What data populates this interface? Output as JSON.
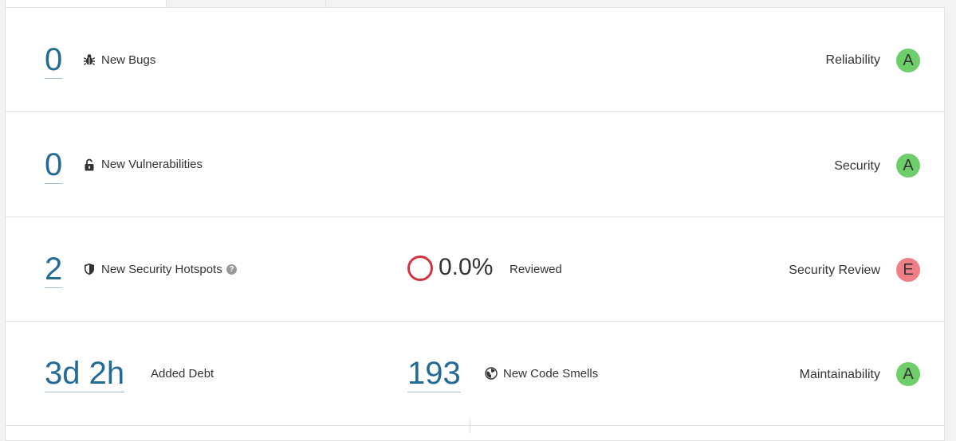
{
  "rows": [
    {
      "value": "0",
      "label": "New Bugs",
      "rating_label": "Reliability",
      "rating": "A"
    },
    {
      "value": "0",
      "label": "New Vulnerabilities",
      "rating_label": "Security",
      "rating": "A"
    },
    {
      "value": "2",
      "label": "New Security Hotspots",
      "help": "?",
      "reviewed_value": "0.0%",
      "reviewed_label": "Reviewed",
      "rating_label": "Security Review",
      "rating": "E"
    },
    {
      "value": "3d 2h",
      "label": "Added Debt",
      "smells_value": "193",
      "smells_label": "New Code Smells",
      "rating_label": "Maintainability",
      "rating": "A"
    }
  ],
  "colors": {
    "link": "#236a97",
    "rating_a": "#6ece69",
    "rating_e": "#ee7f86",
    "ring": "#d0343c"
  },
  "icons": {
    "bugs": "bug-icon",
    "vulnerabilities": "unlock-icon",
    "hotspots": "shield-icon",
    "smells": "radiation-icon"
  }
}
